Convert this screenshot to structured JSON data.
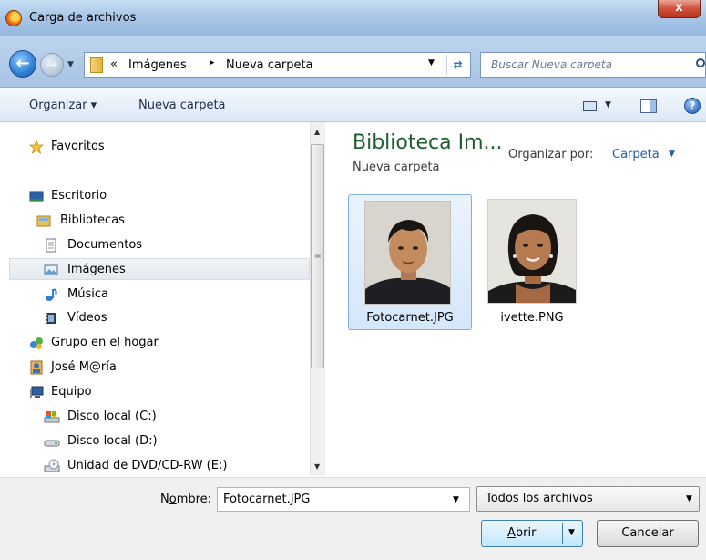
{
  "window": {
    "title": "Carga de archivos",
    "close_glyph": "x"
  },
  "address_bar": {
    "chevron": "«",
    "crumbs": [
      "Imágenes",
      "Nueva carpeta"
    ],
    "separator": "▸"
  },
  "search": {
    "placeholder": "Buscar Nueva carpeta"
  },
  "toolbar": {
    "organize_label": "Organizar ▾",
    "new_folder_label": "Nueva carpeta",
    "help_glyph": "?"
  },
  "nav": {
    "items": [
      {
        "label": "Favoritos",
        "icon": "star-icon"
      },
      {
        "label": "Escritorio",
        "icon": "desktop-icon"
      },
      {
        "label": "Bibliotecas",
        "icon": "libraries-icon"
      },
      {
        "label": "Documentos",
        "icon": "documents-icon"
      },
      {
        "label": "Imágenes",
        "icon": "pictures-icon",
        "selected": true
      },
      {
        "label": "Música",
        "icon": "music-icon"
      },
      {
        "label": "Vídeos",
        "icon": "videos-icon"
      },
      {
        "label": "Grupo en el hogar",
        "icon": "homegroup-icon"
      },
      {
        "label": "José M@ría",
        "icon": "user-icon"
      },
      {
        "label": "Equipo",
        "icon": "computer-icon"
      },
      {
        "label": "Disco local (C:)",
        "icon": "system-drive-icon"
      },
      {
        "label": "Disco local (D:)",
        "icon": "drive-icon"
      },
      {
        "label": "Unidad de DVD/CD-RW (E:)",
        "icon": "dvd-drive-icon"
      }
    ]
  },
  "content": {
    "title": "Biblioteca Im...",
    "subtitle": "Nueva carpeta",
    "arrange_label": "Organizar por:",
    "arrange_value": "Carpeta",
    "files": [
      {
        "name": "Fotocarnet.JPG",
        "selected": true
      },
      {
        "name": "ivette.PNG",
        "selected": false
      }
    ]
  },
  "bottom": {
    "filename_label_prefix": "N",
    "filename_label_accel": "o",
    "filename_label_suffix": "mbre:",
    "filename_value": "Fotocarnet.JPG",
    "filetype_value": "Todos los archivos",
    "open_label_accel": "A",
    "open_label_rest": "brir",
    "cancel_label": "Cancelar"
  },
  "colors": {
    "title_bar": "#a9c7e8",
    "library_title": "#1e5d2e",
    "link": "#1f5da8",
    "close_button": "#c2412b"
  }
}
